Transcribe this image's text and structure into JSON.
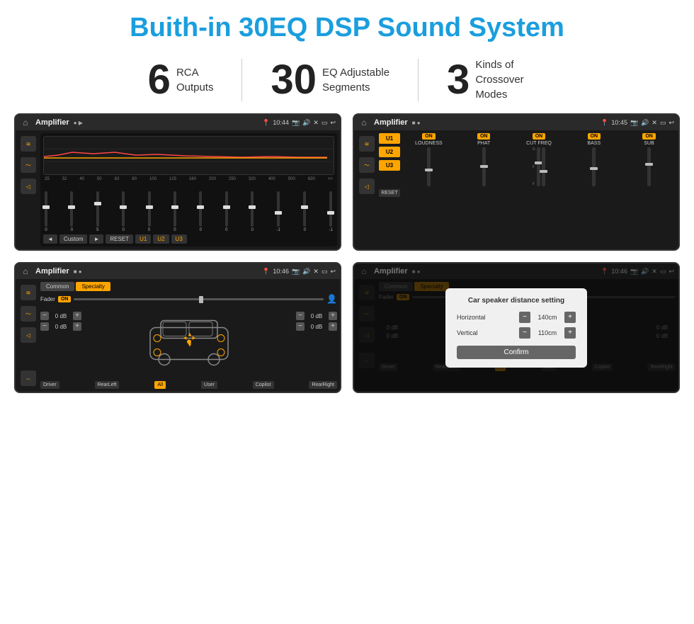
{
  "page": {
    "title": "Buith-in 30EQ DSP Sound System",
    "stats": [
      {
        "number": "6",
        "text": "RCA\nOutputs"
      },
      {
        "number": "30",
        "text": "EQ Adjustable\nSegments"
      },
      {
        "number": "3",
        "text": "Kinds of\nCrossover Modes"
      }
    ]
  },
  "screens": {
    "screen1": {
      "status": {
        "title": "Amplifier",
        "time": "10:44"
      },
      "freqs": [
        "25",
        "32",
        "40",
        "50",
        "63",
        "80",
        "100",
        "125",
        "160",
        "200",
        "250",
        "320",
        "400",
        "500",
        "630"
      ],
      "values": [
        "0",
        "0",
        "0",
        "5",
        "0",
        "0",
        "0",
        "0",
        "0",
        "0",
        "0",
        "-1",
        "0",
        "-1"
      ],
      "bottomBtns": [
        "◄",
        "Custom",
        "►",
        "RESET",
        "U1",
        "U2",
        "U3"
      ]
    },
    "screen2": {
      "status": {
        "title": "Amplifier",
        "time": "10:45"
      },
      "presets": [
        "U1",
        "U2",
        "U3"
      ],
      "channels": [
        "LOUDNESS",
        "PHAT",
        "CUT FREQ",
        "BASS",
        "SUB"
      ],
      "resetBtn": "RESET"
    },
    "screen3": {
      "status": {
        "title": "Amplifier",
        "time": "10:46"
      },
      "tabs": [
        "Common",
        "Specialty"
      ],
      "activeTab": "Specialty",
      "faderLabel": "Fader",
      "faderOn": "ON",
      "dbValues": [
        "0 dB",
        "0 dB",
        "0 dB",
        "0 dB"
      ],
      "bottomBtns": [
        "Driver",
        "RearLeft",
        "All",
        "User",
        "Copilot",
        "RearRight"
      ]
    },
    "screen4": {
      "status": {
        "title": "Amplifier",
        "time": "10:46"
      },
      "tabs": [
        "Common",
        "Specialty"
      ],
      "dialog": {
        "title": "Car speaker distance setting",
        "horizontal": {
          "label": "Horizontal",
          "value": "140cm"
        },
        "vertical": {
          "label": "Vertical",
          "value": "110cm"
        },
        "confirmBtn": "Confirm"
      },
      "dbValues": [
        "0 dB",
        "0 dB"
      ],
      "bottomBtns": [
        "Driver",
        "RearLef...",
        "All",
        "User",
        "Copilot",
        "RearRight"
      ]
    }
  },
  "icons": {
    "home": "⌂",
    "back": "↩",
    "location": "📍",
    "speaker": "🔊",
    "camera": "📷",
    "eq": "≋",
    "wave": "〜",
    "volume": "◁",
    "settings": "⚙",
    "person": "👤"
  }
}
